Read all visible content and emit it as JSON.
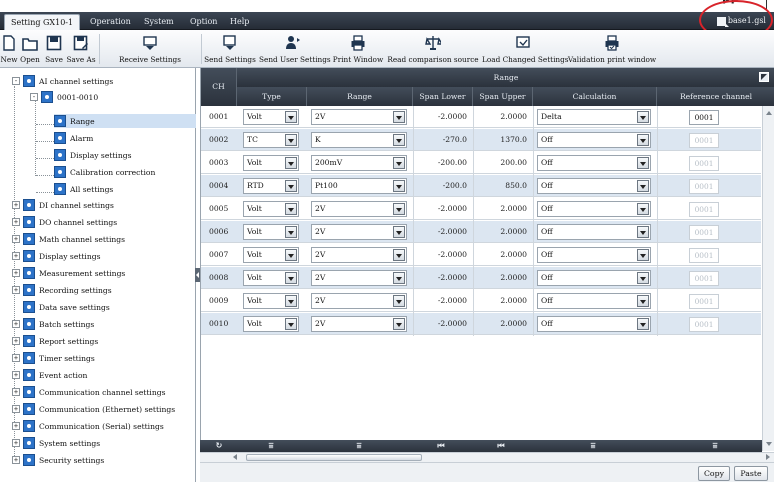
{
  "top_annotation": {
    "fragment": "pp"
  },
  "menubar": {
    "tabs": [
      {
        "label": "Setting GX10-1",
        "active": true
      },
      {
        "label": "Operation"
      },
      {
        "label": "System"
      },
      {
        "label": "Option"
      },
      {
        "label": "Help"
      }
    ],
    "file_name": "base1.gsl"
  },
  "toolbar": {
    "buttons": [
      {
        "label": "New",
        "icon": "new-file-icon"
      },
      {
        "label": "Open",
        "icon": "open-folder-icon"
      },
      {
        "label": "Save",
        "icon": "save-icon"
      },
      {
        "label": "Save As",
        "icon": "save-as-icon"
      },
      {
        "label": "Receive Settings",
        "icon": "receive-settings-icon"
      },
      {
        "label": "Send Settings",
        "icon": "send-settings-icon"
      },
      {
        "label": "Send User Settings",
        "icon": "send-user-settings-icon"
      },
      {
        "label": "Print Window",
        "icon": "print-icon"
      },
      {
        "label": "Read comparison source",
        "icon": "compare-icon"
      },
      {
        "label": "Load Changed Settings",
        "icon": "load-changed-icon"
      },
      {
        "label": "Validation print window",
        "icon": "validation-print-icon"
      }
    ]
  },
  "tree": {
    "items": [
      {
        "label": "AI channel settings",
        "level": 0,
        "expander": "-"
      },
      {
        "label": "0001-0010",
        "level": 1,
        "expander": "-"
      },
      {
        "label": "Range",
        "level": 2,
        "selected": true
      },
      {
        "label": "Alarm",
        "level": 2
      },
      {
        "label": "Display settings",
        "level": 2
      },
      {
        "label": "Calibration correction",
        "level": 2
      },
      {
        "label": "All settings",
        "level": 2
      },
      {
        "label": "DI channel settings",
        "level": 0,
        "expander": "+"
      },
      {
        "label": "DO channel settings",
        "level": 0,
        "expander": "+"
      },
      {
        "label": "Math channel settings",
        "level": 0,
        "expander": "+"
      },
      {
        "label": "Display settings",
        "level": 0,
        "expander": "+"
      },
      {
        "label": "Measurement settings",
        "level": 0,
        "expander": "+"
      },
      {
        "label": "Recording settings",
        "level": 0,
        "expander": "+"
      },
      {
        "label": "Data save settings",
        "level": 0,
        "expander": ""
      },
      {
        "label": "Batch settings",
        "level": 0,
        "expander": "+"
      },
      {
        "label": "Report settings",
        "level": 0,
        "expander": "+"
      },
      {
        "label": "Timer settings",
        "level": 0,
        "expander": "+"
      },
      {
        "label": "Event action",
        "level": 0,
        "expander": "+"
      },
      {
        "label": "Communication channel settings",
        "level": 0,
        "expander": "+"
      },
      {
        "label": "Communication (Ethernet) settings",
        "level": 0,
        "expander": "+"
      },
      {
        "label": "Communication (Serial) settings",
        "level": 0,
        "expander": "+"
      },
      {
        "label": "System settings",
        "level": 0,
        "expander": "+"
      },
      {
        "label": "Security settings",
        "level": 0,
        "expander": "+"
      }
    ]
  },
  "grid": {
    "group_header": "Range",
    "ch_header": "CH",
    "columns": [
      "Type",
      "Range",
      "Span Lower",
      "Span Upper",
      "Calculation",
      "Reference channel"
    ],
    "rows": [
      {
        "ch": "0001",
        "type": "Volt",
        "range": "2V",
        "span_lower": "-2.0000",
        "span_upper": "2.0000",
        "calculation": "Delta",
        "reference": "0001",
        "ref_enabled": true
      },
      {
        "ch": "0002",
        "type": "TC",
        "range": "K",
        "span_lower": "-270.0",
        "span_upper": "1370.0",
        "calculation": "Off",
        "reference": "0001",
        "ref_enabled": false
      },
      {
        "ch": "0003",
        "type": "Volt",
        "range": "200mV",
        "span_lower": "-200.00",
        "span_upper": "200.00",
        "calculation": "Off",
        "reference": "0001",
        "ref_enabled": false
      },
      {
        "ch": "0004",
        "type": "RTD",
        "range": "Pt100",
        "span_lower": "-200.0",
        "span_upper": "850.0",
        "calculation": "Off",
        "reference": "0001",
        "ref_enabled": false
      },
      {
        "ch": "0005",
        "type": "Volt",
        "range": "2V",
        "span_lower": "-2.0000",
        "span_upper": "2.0000",
        "calculation": "Off",
        "reference": "0001",
        "ref_enabled": false
      },
      {
        "ch": "0006",
        "type": "Volt",
        "range": "2V",
        "span_lower": "-2.0000",
        "span_upper": "2.0000",
        "calculation": "Off",
        "reference": "0001",
        "ref_enabled": false
      },
      {
        "ch": "0007",
        "type": "Volt",
        "range": "2V",
        "span_lower": "-2.0000",
        "span_upper": "2.0000",
        "calculation": "Off",
        "reference": "0001",
        "ref_enabled": false
      },
      {
        "ch": "0008",
        "type": "Volt",
        "range": "2V",
        "span_lower": "-2.0000",
        "span_upper": "2.0000",
        "calculation": "Off",
        "reference": "0001",
        "ref_enabled": false
      },
      {
        "ch": "0009",
        "type": "Volt",
        "range": "2V",
        "span_lower": "-2.0000",
        "span_upper": "2.0000",
        "calculation": "Off",
        "reference": "0001",
        "ref_enabled": false
      },
      {
        "ch": "0010",
        "type": "Volt",
        "range": "2V",
        "span_lower": "-2.0000",
        "span_upper": "2.0000",
        "calculation": "Off",
        "reference": "0001",
        "ref_enabled": false
      }
    ]
  },
  "footer": {
    "copy_label": "Copy",
    "paste_label": "Paste"
  },
  "colors": {
    "header_dark": "#2b323c",
    "row_alt": "#dce6f1",
    "tree_selected": "#cfe0f3",
    "gear_blue": "#2d73c8",
    "annotation_red": "#d8232a"
  }
}
